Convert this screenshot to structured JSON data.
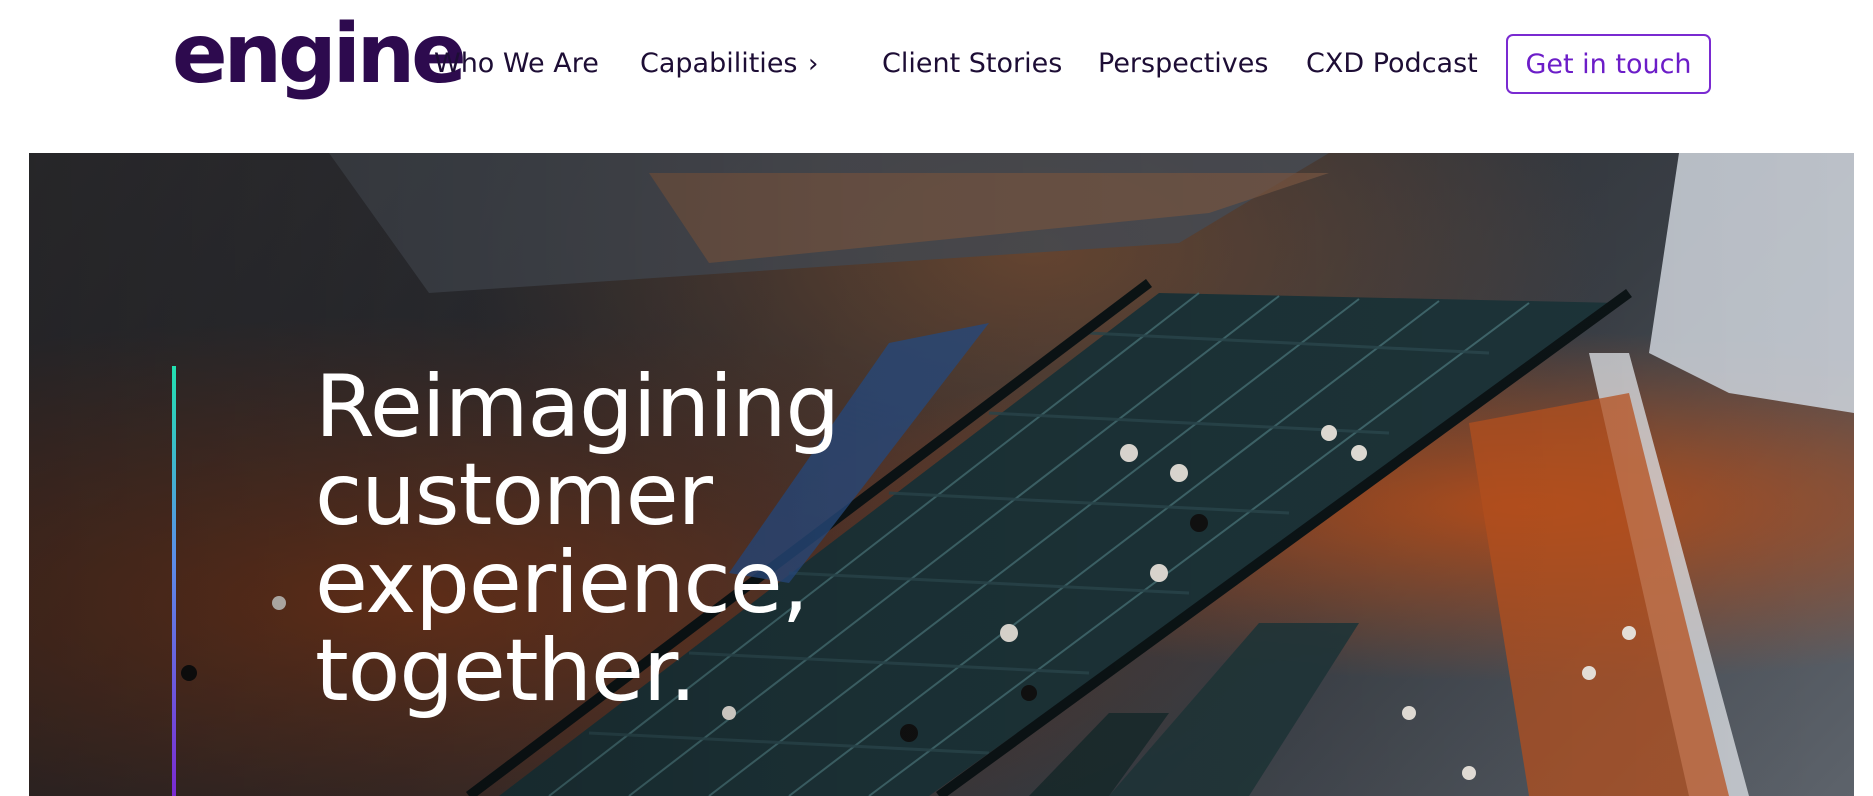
{
  "brand": {
    "logo_text": "engine",
    "logo_color": "#2d0a4e"
  },
  "nav": {
    "items": [
      {
        "label": "Who We Are"
      },
      {
        "label": "Capabilities",
        "has_submenu": true
      },
      {
        "label": "Client Stories"
      },
      {
        "label": "Perspectives"
      },
      {
        "label": "CXD Podcast"
      }
    ],
    "chevron": "›",
    "cta_label": "Get in touch",
    "cta_color": "#7a2ad1"
  },
  "hero": {
    "headline_lines": [
      "Reimagining",
      "customer",
      "experience,",
      "together."
    ],
    "background_description_icon": "escalator-mall-photo",
    "accent_gradient": [
      "#22e0b0",
      "#5b8de8",
      "#7a2ad1"
    ]
  }
}
